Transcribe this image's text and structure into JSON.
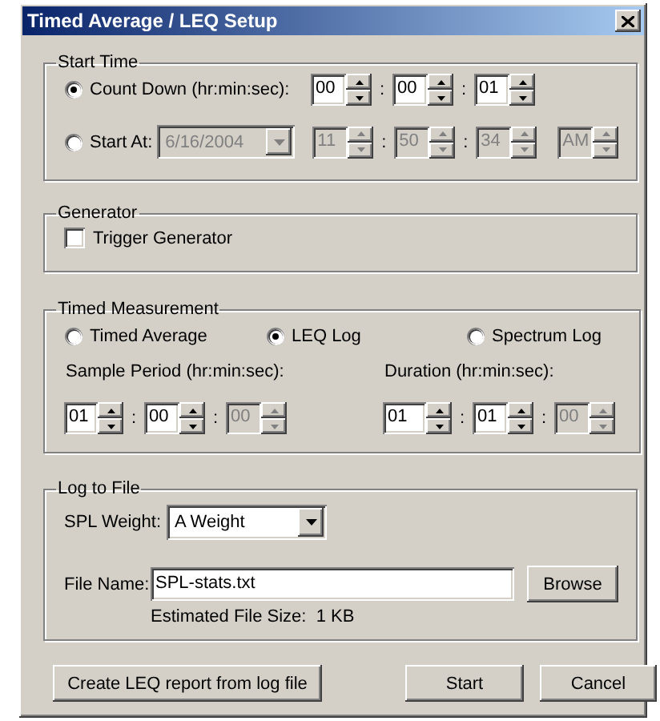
{
  "window": {
    "title": "Timed Average / LEQ Setup"
  },
  "start_time": {
    "label": "Start Time",
    "options": [
      {
        "label": "Count Down (hr:min:sec):",
        "selected": true,
        "time": [
          {
            "kind": "spin",
            "value": "00",
            "disabled": false
          },
          {
            "kind": "separator",
            "text": ":"
          },
          {
            "kind": "spin",
            "value": "00",
            "disabled": false
          },
          {
            "kind": "separator",
            "text": ":"
          },
          {
            "kind": "spin",
            "value": "01",
            "disabled": false
          }
        ]
      },
      {
        "label": "Start At:",
        "selected": false,
        "date": {
          "value": "6/16/2004",
          "disabled": true
        },
        "time": [
          {
            "kind": "spin",
            "value": "11",
            "disabled": true
          },
          {
            "kind": "separator",
            "text": ":"
          },
          {
            "kind": "spin",
            "value": "50",
            "disabled": true
          },
          {
            "kind": "separator",
            "text": ":"
          },
          {
            "kind": "spin",
            "value": "34",
            "disabled": true
          },
          {
            "kind": "gap"
          },
          {
            "kind": "spin",
            "value": "AM",
            "disabled": true
          }
        ]
      }
    ]
  },
  "generator": {
    "label": "Generator",
    "checkbox": {
      "label": "Trigger Generator",
      "checked": false
    }
  },
  "timed_measurement": {
    "label": "Timed Measurement",
    "modes": [
      {
        "label": "Timed Average",
        "selected": false
      },
      {
        "label": "LEQ Log",
        "selected": true
      },
      {
        "label": "Spectrum Log",
        "selected": false
      }
    ],
    "periods": [
      {
        "label": "Sample Period (hr:min:sec):",
        "time": [
          {
            "kind": "spin",
            "value": "01",
            "disabled": false
          },
          {
            "kind": "separator",
            "text": ":"
          },
          {
            "kind": "spin",
            "value": "00",
            "disabled": false
          },
          {
            "kind": "separator",
            "text": ":"
          },
          {
            "kind": "spin",
            "value": "00",
            "disabled": true
          }
        ]
      },
      {
        "label": "Duration (hr:min:sec):",
        "time": [
          {
            "kind": "spin",
            "value": "01",
            "disabled": false
          },
          {
            "kind": "separator",
            "text": ":"
          },
          {
            "kind": "spin",
            "value": "01",
            "disabled": false
          },
          {
            "kind": "separator",
            "text": ":"
          },
          {
            "kind": "spin",
            "value": "00",
            "disabled": true
          }
        ]
      }
    ]
  },
  "log_to_file": {
    "label": "Log to File",
    "spl_weight": {
      "label": "SPL Weight:",
      "value": "A Weight"
    },
    "file_name": {
      "label": "File Name:",
      "value": "SPL-stats.txt"
    },
    "browse": "Browse",
    "estimate": "Estimated File Size:  1 KB"
  },
  "buttons": [
    "Create LEQ report from log file",
    "Start",
    "Cancel"
  ]
}
